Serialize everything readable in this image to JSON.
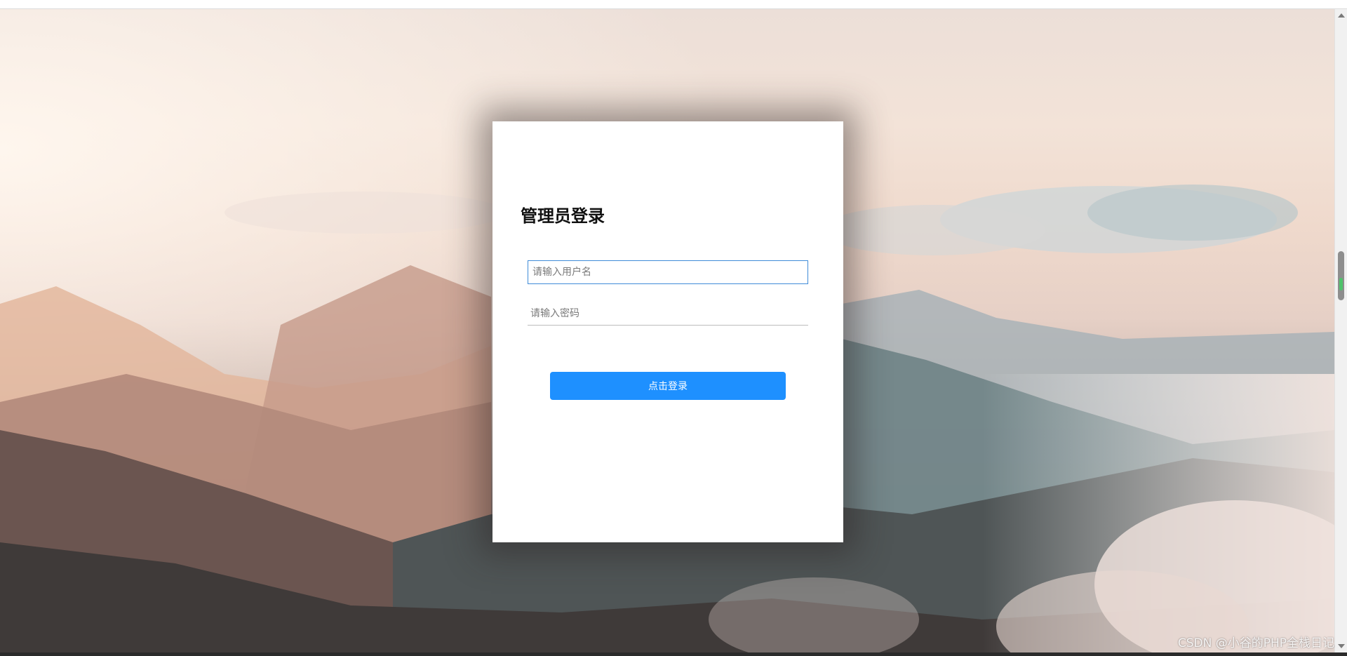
{
  "login": {
    "title": "管理员登录",
    "username_placeholder": "请输入用户名",
    "password_placeholder": "请输入密码",
    "submit_label": "点击登录"
  },
  "watermark": "CSDN @小谷的PHP全栈日记",
  "colors": {
    "primary_button": "#1e90ff",
    "active_input_border": "#3f8bd8",
    "card_background": "#ffffff"
  },
  "background": {
    "description_icon": "mountain-landscape-image"
  }
}
